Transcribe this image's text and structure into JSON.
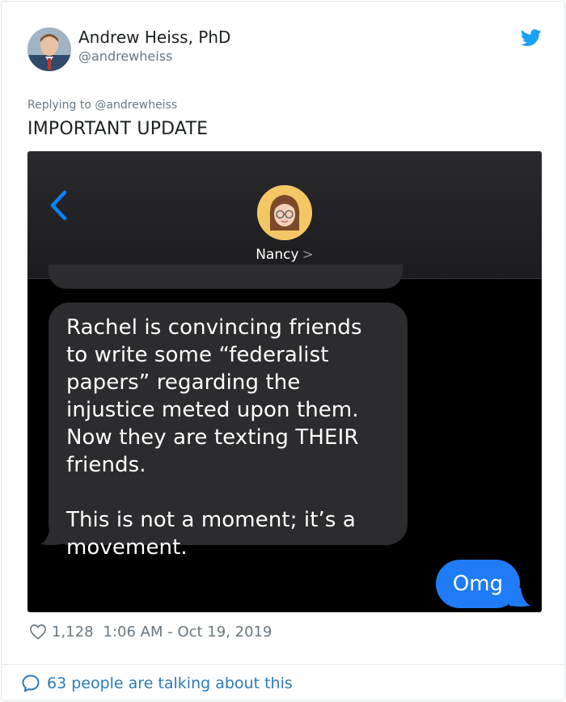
{
  "author": {
    "name": "Andrew Heiss, PhD",
    "handle": "@andrewheiss"
  },
  "tweet": {
    "replying_prefix": "Replying to",
    "replying_handle": "@andrewheiss",
    "text": "IMPORTANT UPDATE"
  },
  "media": {
    "contact_name": "Nancy",
    "contact_chevron": ">",
    "incoming_message_p1": "Rachel is convincing friends to write some “federalist papers” regarding the injustice meted upon them. Now they are texting THEIR friends.",
    "incoming_message_p2": "This is not a moment; it’s a movement.",
    "outgoing_message": "Omg"
  },
  "footer": {
    "likes": "1,128",
    "timestamp": "1:06 AM - Oct 19, 2019",
    "talking": "63 people are talking about this"
  },
  "colors": {
    "twitter_blue": "#1da1f2",
    "imessage_blue": "#1f7cf6",
    "link_blue": "#2b7bb9",
    "muted_gray": "#697882"
  },
  "icons": [
    "twitter-bird-icon",
    "back-chevron-icon",
    "heart-icon",
    "comment-bubble-icon"
  ]
}
